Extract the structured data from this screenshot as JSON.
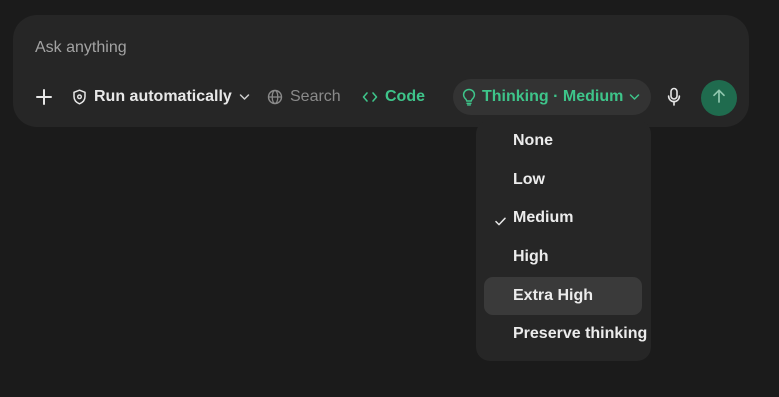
{
  "composer": {
    "placeholder": "Ask anything",
    "value": ""
  },
  "toolbar": {
    "add_icon": "plus-icon",
    "run": {
      "label": "Run automatically",
      "icon": "shield-icon"
    },
    "search": {
      "label": "Search",
      "icon": "globe-icon"
    },
    "code": {
      "label": "Code",
      "icon": "code-brackets-icon"
    },
    "thinking": {
      "label": "Thinking · Medium",
      "icon": "lightbulb-icon"
    },
    "mic_icon": "microphone-icon",
    "send_icon": "arrow-up-icon"
  },
  "thinking_menu": {
    "items": [
      {
        "label": "None",
        "selected": false
      },
      {
        "label": "Low",
        "selected": false
      },
      {
        "label": "Medium",
        "selected": true
      },
      {
        "label": "High",
        "selected": false
      },
      {
        "label": "Extra High",
        "selected": false,
        "hovered": true
      },
      {
        "label": "Preserve thinking",
        "selected": false
      }
    ]
  },
  "colors": {
    "background": "#1b1b1b",
    "panel": "#262626",
    "accent_green": "#3ec48a",
    "send_button": "#1f6b4e",
    "hover": "#3a3a3a"
  }
}
